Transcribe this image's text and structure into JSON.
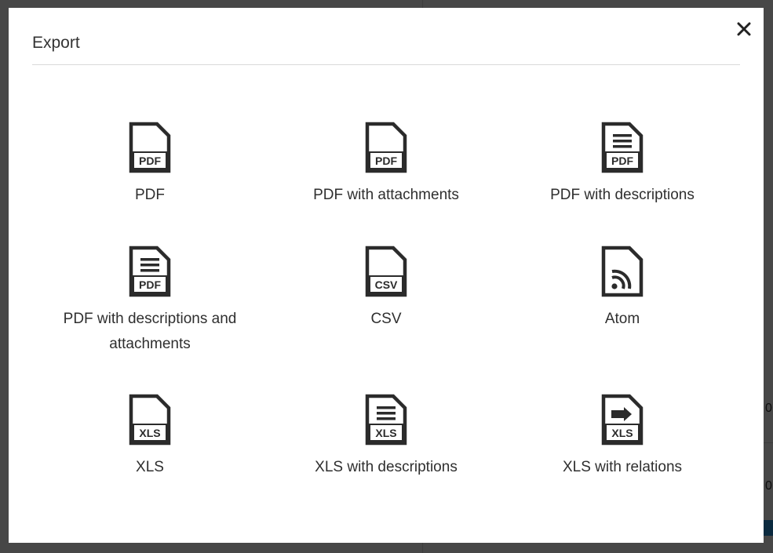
{
  "modal": {
    "title": "Export",
    "close_symbol": "×"
  },
  "background": {
    "fragment_a": "0",
    "fragment_b": "0"
  },
  "options": [
    {
      "label": "PDF",
      "icon": "pdf-file-icon",
      "badge": "PDF"
    },
    {
      "label": "PDF with attachments",
      "icon": "pdf-attachments-file-icon",
      "badge": "PDF"
    },
    {
      "label": "PDF with descriptions",
      "icon": "pdf-descriptions-file-icon",
      "badge": "PDF"
    },
    {
      "label": "PDF with descriptions and attachments",
      "icon": "pdf-descriptions-attachments-file-icon",
      "badge": "PDF"
    },
    {
      "label": "CSV",
      "icon": "csv-file-icon",
      "badge": "CSV"
    },
    {
      "label": "Atom",
      "icon": "atom-feed-file-icon",
      "badge": ""
    },
    {
      "label": "XLS",
      "icon": "xls-file-icon",
      "badge": "XLS"
    },
    {
      "label": "XLS with descriptions",
      "icon": "xls-descriptions-file-icon",
      "badge": "XLS"
    },
    {
      "label": "XLS with relations",
      "icon": "xls-relations-file-icon",
      "badge": "XLS"
    }
  ],
  "colors": {
    "icon": "#2b2b2b",
    "text": "#2f2f2f",
    "overlay": "#4a4a4a",
    "modal_bg": "#ffffff"
  }
}
